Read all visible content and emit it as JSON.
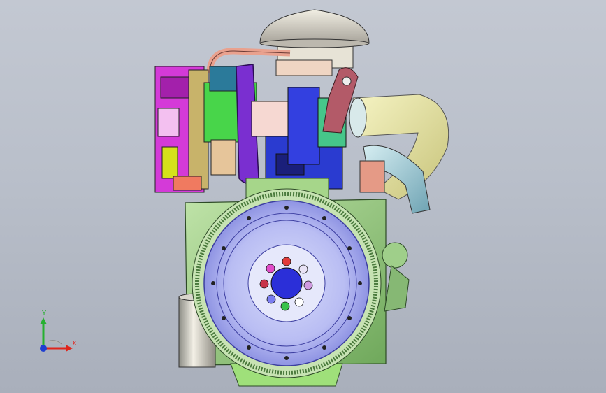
{
  "viewport": {
    "background_top": "#c3c8d2",
    "background_bottom": "#a9afbb"
  },
  "model": {
    "icon": "engine-assembly-icon"
  },
  "triad": {
    "x_label": "X",
    "y_label": "Y",
    "x_color": "#e0241b",
    "y_color": "#26b030",
    "z_color": "#1f3fd0"
  }
}
